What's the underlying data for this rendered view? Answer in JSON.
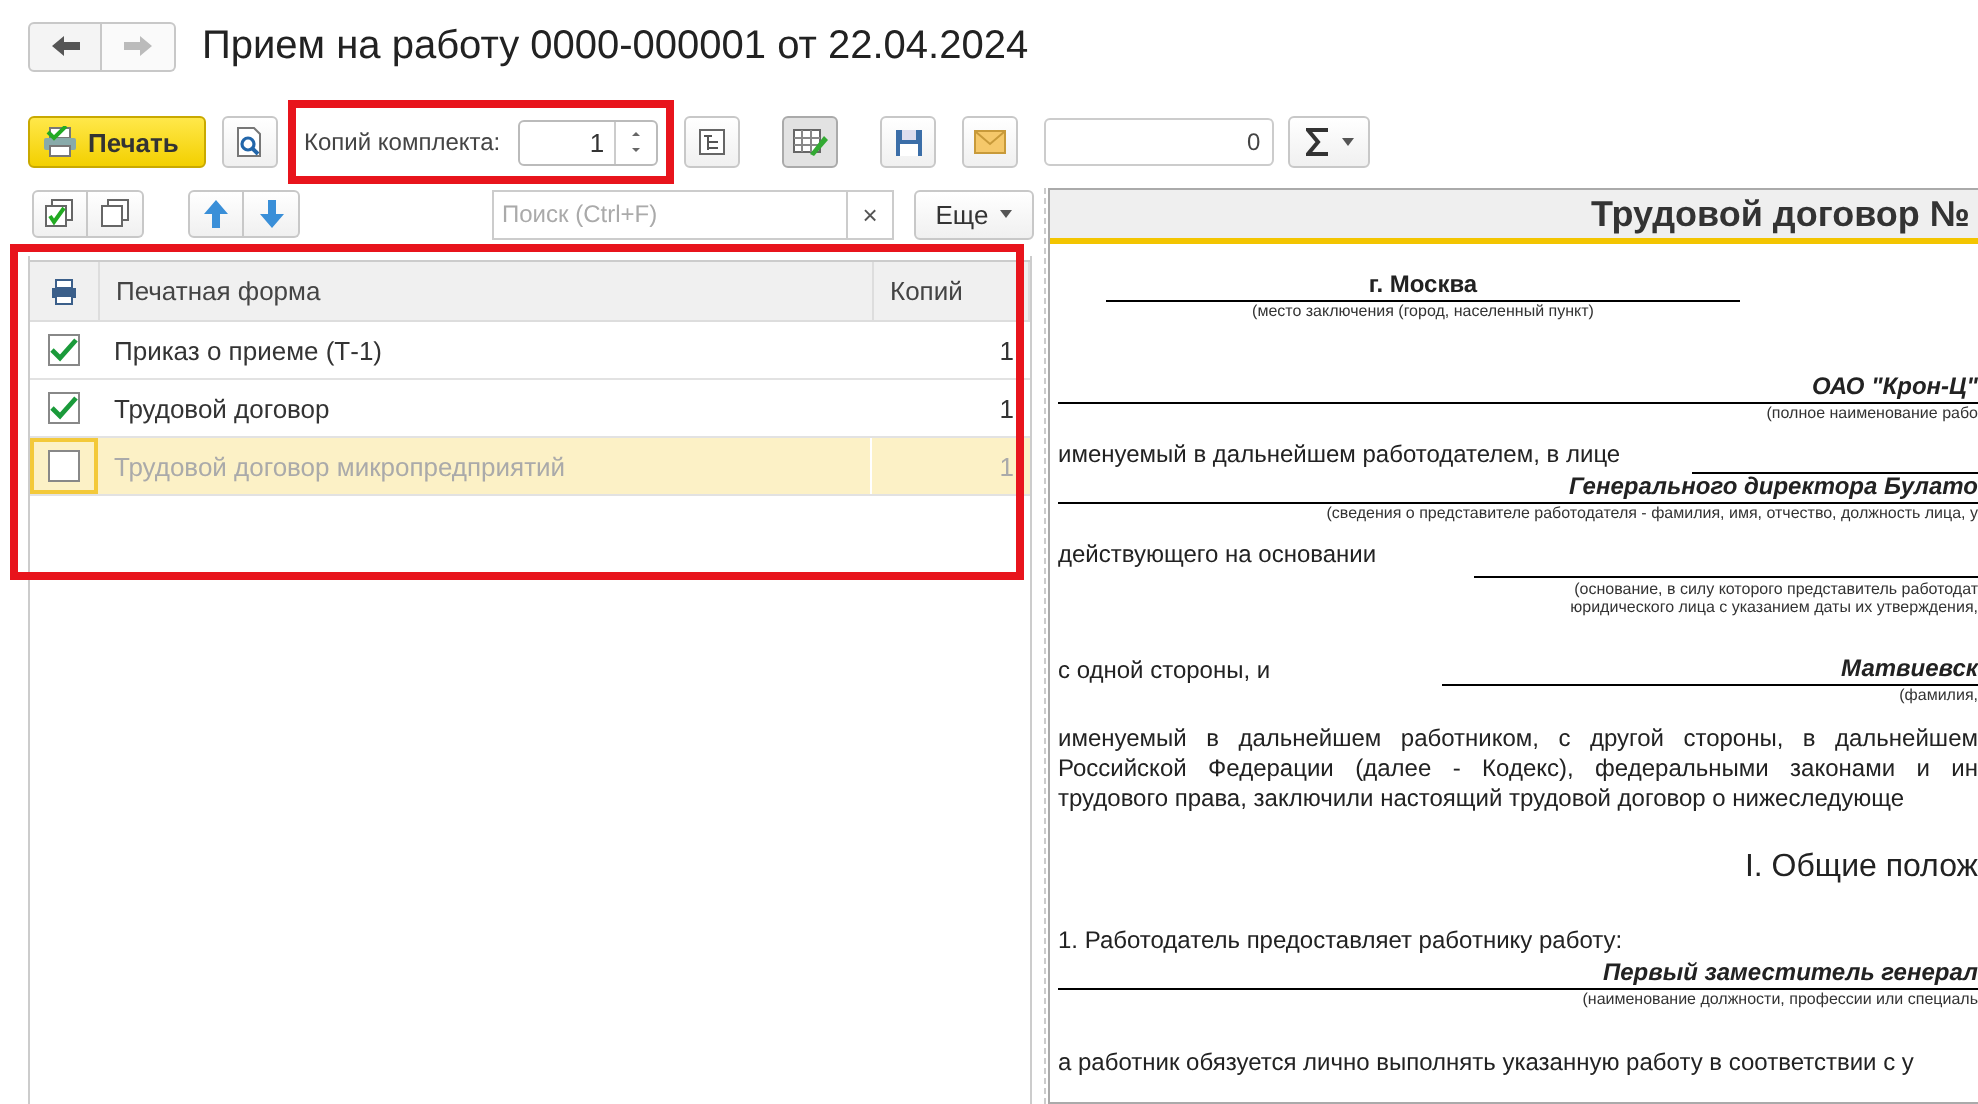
{
  "window": {
    "title": "Прием на работу 0000-000001 от 22.04.2024"
  },
  "nav": [
    {
      "kind": "back",
      "disabled": false
    },
    {
      "kind": "forward",
      "disabled": true
    }
  ],
  "toolbar": {
    "print_button": "Печать",
    "copies_label": "Копий комплекта:",
    "copies_value": "1",
    "counter_value": "0",
    "edit_pressed": true
  },
  "list_toolbar": {
    "search_placeholder": "Поиск (Ctrl+F)",
    "clear": "×",
    "more_button": "Еще"
  },
  "table": {
    "columns": [
      "Печатная форма",
      "Копий"
    ],
    "rows": [
      {
        "checked": true,
        "name": "Приказ о приеме (Т-1)",
        "copies": "1",
        "selected": false
      },
      {
        "checked": true,
        "name": "Трудовой договор",
        "copies": "1",
        "selected": false
      },
      {
        "checked": false,
        "name": "Трудовой договор микропредприятий",
        "copies": "1",
        "selected": true
      }
    ]
  },
  "document": {
    "title": "Трудовой договор №",
    "blocks": [
      {
        "kind": "center_field",
        "value": "г. Москва",
        "caption": [
          "(место заключения (город, населенный пункт)"
        ]
      },
      {
        "kind": "right_field",
        "value": "ОАО \"Крон-Ц\"",
        "caption": [
          "(полное наименование рабо"
        ]
      },
      {
        "kind": "label_line",
        "text": "именуемый в дальнейшем работодателем, в лице"
      },
      {
        "kind": "right_field",
        "value": "Генерального директора Булато",
        "caption": [
          "(сведения о представителе работодателя - фамилия, имя, отчество, должность лица, у"
        ]
      },
      {
        "kind": "label_caption",
        "text": "действующего на основании",
        "caption": [
          "(основание, в силу которого представитель работодат",
          "юридического лица с указанием даты их утверждения,"
        ]
      },
      {
        "kind": "label_value",
        "text": "с одной стороны, и",
        "value": "Матвиевск",
        "caption": [
          "(фамилия,"
        ]
      },
      {
        "kind": "paragraph",
        "lines": [
          "именуемый в дальнейшем работником, с другой стороны, в дальнейшем",
          "Российской Федерации (далее - Кодекс), федеральными законами и ин",
          "трудового права, заключили настоящий трудовой договор о нижеследующе"
        ]
      },
      {
        "kind": "heading",
        "text": "I. Общие полож"
      },
      {
        "kind": "text",
        "text": "1. Работодатель предоставляет работнику работу:"
      },
      {
        "kind": "right_field",
        "value": "Первый заместитель генерал",
        "caption": [
          "(наименование должности, профессии или специаль"
        ]
      },
      {
        "kind": "text",
        "text": "а работник обязуется лично выполнять указанную работу в соответствии с у"
      }
    ]
  }
}
